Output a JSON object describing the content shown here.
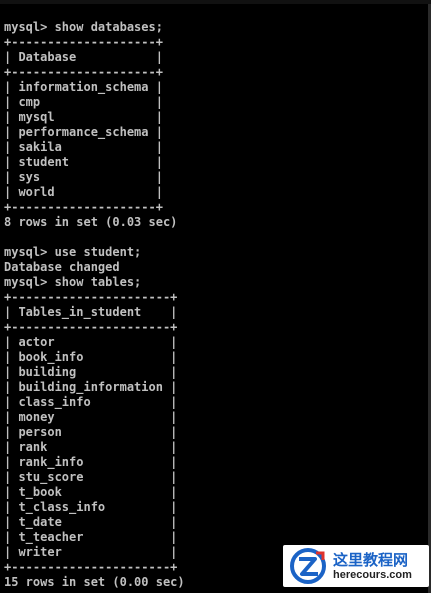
{
  "terminal": {
    "lines": [
      "mysql> show databases;",
      "+--------------------+",
      "| Database           |",
      "+--------------------+",
      "| information_schema |",
      "| cmp                |",
      "| mysql              |",
      "| performance_schema |",
      "| sakila             |",
      "| student            |",
      "| sys                |",
      "| world              |",
      "+--------------------+",
      "8 rows in set (0.03 sec)",
      "",
      "mysql> use student;",
      "Database changed",
      "mysql> show tables;",
      "+----------------------+",
      "| Tables_in_student    |",
      "+----------------------+",
      "| actor                |",
      "| book_info            |",
      "| building             |",
      "| building_information |",
      "| class_info           |",
      "| money                |",
      "| person               |",
      "| rank                 |",
      "| rank_info            |",
      "| stu_score            |",
      "| t_book               |",
      "| t_class_info         |",
      "| t_date               |",
      "| t_teacher            |",
      "| writer               |",
      "+----------------------+",
      "15 rows in set (0.00 sec)"
    ]
  },
  "watermark": {
    "title": "这里教程网",
    "url": "herecours.com",
    "colors": {
      "title": "#1b63c6",
      "logo_ring": "#1b63c6",
      "logo_accent": "#e0322b"
    }
  },
  "colors": {
    "background": "#000000",
    "text": "#c0c0c0"
  }
}
